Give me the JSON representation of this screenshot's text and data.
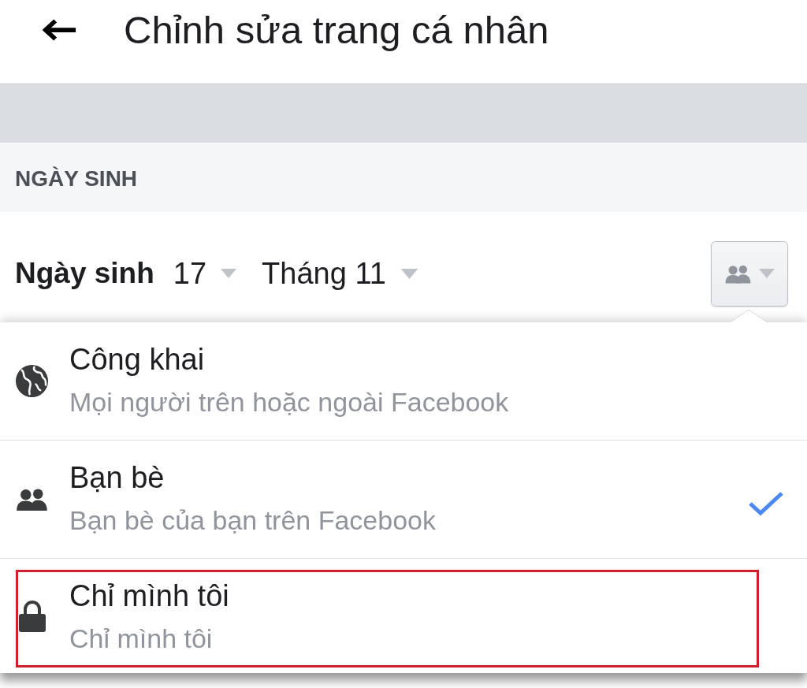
{
  "header": {
    "title": "Chỉnh sửa trang cá nhân"
  },
  "section": {
    "heading": "NGÀY SINH"
  },
  "birthday": {
    "label": "Ngày sinh",
    "day": "17",
    "month": "Tháng 11",
    "audience_button": {
      "expanded": true
    }
  },
  "audience_menu": {
    "options": [
      {
        "kind": "public",
        "label": "Công khai",
        "description": "Mọi người trên hoặc ngoài Facebook",
        "selected": false,
        "highlighted": false
      },
      {
        "kind": "friends",
        "label": "Bạn bè",
        "description": "Bạn bè của bạn trên Facebook",
        "selected": true,
        "highlighted": false
      },
      {
        "kind": "private",
        "label": "Chỉ mình tôi",
        "description": "Chỉ mình tôi",
        "selected": false,
        "highlighted": true
      }
    ]
  }
}
